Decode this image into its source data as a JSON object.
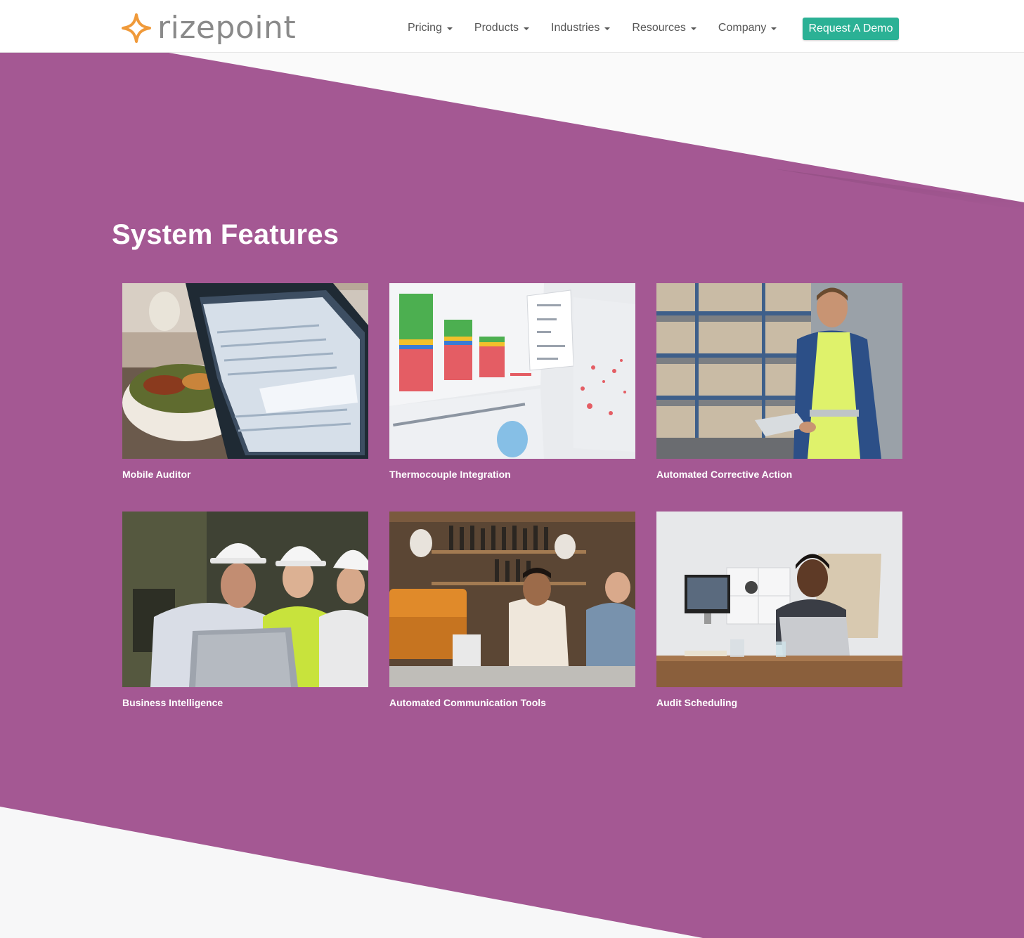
{
  "header": {
    "logo_text": "rizepoint",
    "nav": [
      {
        "label": "Pricing"
      },
      {
        "label": "Products"
      },
      {
        "label": "Industries"
      },
      {
        "label": "Resources"
      },
      {
        "label": "Company"
      }
    ],
    "cta_label": "Request A Demo"
  },
  "colors": {
    "band": "#a45893",
    "cta": "#2bb195",
    "logo_orange": "#f09a3a"
  },
  "main": {
    "title": "System Features",
    "features": [
      {
        "label": "Mobile Auditor",
        "image": "tablet-restaurant-photo"
      },
      {
        "label": "Thermocouple Integration",
        "image": "dashboard-chart-photo"
      },
      {
        "label": "Automated Corrective Action",
        "image": "warehouse-worker-photo"
      },
      {
        "label": "Business Intelligence",
        "image": "hardhat-team-photo"
      },
      {
        "label": "Automated Communication Tools",
        "image": "cafe-staff-photo"
      },
      {
        "label": "Audit Scheduling",
        "image": "office-desk-photo"
      }
    ]
  }
}
